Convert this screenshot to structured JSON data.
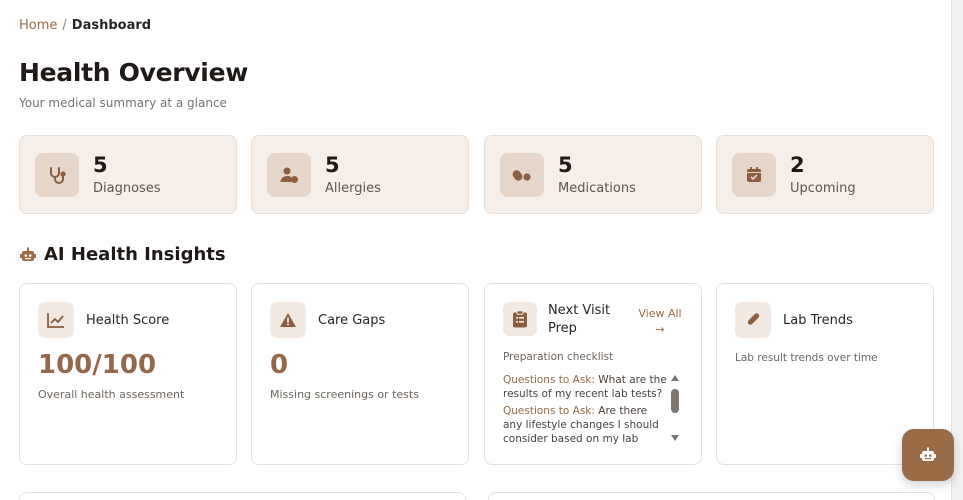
{
  "breadcrumb": {
    "home": "Home",
    "separator": "/",
    "current": "Dashboard"
  },
  "header": {
    "title": "Health Overview",
    "subtitle": "Your medical summary at a glance"
  },
  "stats": [
    {
      "value": "5",
      "label": "Diagnoses",
      "icon": "stethoscope-icon"
    },
    {
      "value": "5",
      "label": "Allergies",
      "icon": "user-allergy-icon"
    },
    {
      "value": "5",
      "label": "Medications",
      "icon": "pills-icon"
    },
    {
      "value": "2",
      "label": "Upcoming",
      "icon": "calendar-check-icon"
    }
  ],
  "insights": {
    "section_title": "AI Health Insights",
    "health_score": {
      "title": "Health Score",
      "value": "100/100",
      "desc": "Overall health assessment"
    },
    "care_gaps": {
      "title": "Care Gaps",
      "value": "0",
      "desc": "Missing screenings or tests"
    },
    "visit_prep": {
      "title": "Next Visit Prep",
      "view_all": "View All →",
      "subtitle": "Preparation checklist",
      "items": [
        {
          "label": "Questions to Ask:",
          "text": "What are the results of my recent lab tests?"
        },
        {
          "label": "Questions to Ask:",
          "text": "Are there any lifestyle changes I should consider based on my lab results?"
        }
      ]
    },
    "lab_trends": {
      "title": "Lab Trends",
      "desc": "Lab result trends over time"
    }
  },
  "colors": {
    "accent": "#9a6b47",
    "card_bg": "#f5eee9",
    "icon_bg": "#e6d6ca"
  }
}
